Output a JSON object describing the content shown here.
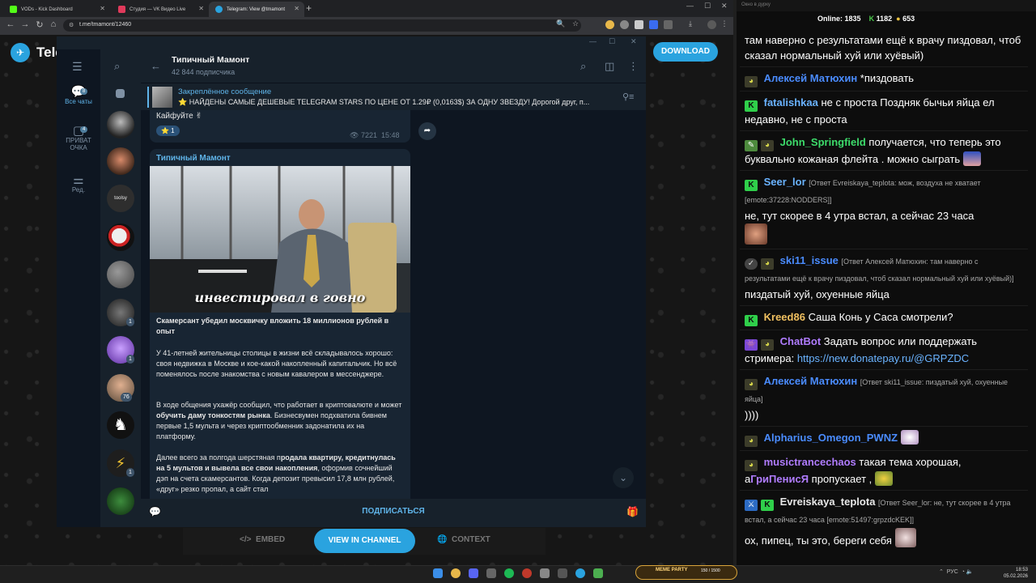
{
  "browser": {
    "tabs": [
      {
        "label": "VODs - Kick Dashboard",
        "favicon_color": "#53fc18"
      },
      {
        "label": "Студия — VK Видео Live",
        "favicon_color": "#e03a5b"
      },
      {
        "label": "Telegram: View @tmamont",
        "favicon_color": "#2aa3df"
      }
    ],
    "new_tab": "+",
    "url": "t.me/tmamont/12460"
  },
  "telegram_web": {
    "logo_word": "Tele",
    "download_label": "DOWNLOAD",
    "embed_label": "EMBED",
    "view_in_channel_label": "VIEW IN CHANNEL",
    "context_label": "CONTEXT"
  },
  "app": {
    "folders": [
      {
        "label": "Все чаты",
        "badge": "8",
        "icon": "chat-bubbles-icon"
      },
      {
        "label": "ПРИВАТ ОЧКА",
        "badge": "4",
        "icon": "chat-bubble-icon"
      },
      {
        "label": "Ред.",
        "icon": "sliders-icon"
      }
    ],
    "chat_badges": [
      "1",
      "1",
      "76",
      "1"
    ],
    "channel": {
      "title": "Типичный Мамонт",
      "subscribers": "42 844 подписчика"
    },
    "pinned": {
      "title": "Закреплённое сообщение",
      "text": "⭐ НАЙДЕНЫ САМЫЕ ДЕШЕВЫЕ TELEGRAM STARS ПО ЦЕНЕ ОТ 1.29₽ (0,0163$) ЗА ОДНУ ЗВЕЗДУ! Дорогой друг, п..."
    },
    "message1": {
      "text": "Кайфуйте ✌",
      "reaction": "⭐ 1",
      "views": "7221",
      "time": "15:48"
    },
    "post": {
      "author": "Типичный Мамонт",
      "image_caption": "инвестировал в говно",
      "headline": "Скамерсант убедил москвичку вложить 18 миллионов рублей в опыт",
      "p1": "У 41-летней жительницы столицы в жизни всё складывалось хорошо: своя недвижка в Москве и кое-какой накопленный капитальчик. Но всё поменялось после знакомства с новым кавалером в мессенджере.",
      "p2_a": "В ходе общения ухажёр сообщил, что работает в криптовалюте и может ",
      "p2_b": "обучить даму тонкостям рынка",
      "p2_c": ". Бизнесвумен подхватила бивнем первые 1,5 мульта и через криптообменник задонатила их на платформу.",
      "p3_a": "Далее всего за полгода шерстяная п",
      "p3_b": "родала квартиру, кредитнулась на 5 мультов и вывела все свои накопления",
      "p3_c": ", оформив сочнейший дэп на счета скамерсантов. Когда депозит превысил 17,8 млн рублей, «друг» резко пропал, а сайт стал"
    },
    "subscribe_label": "ПОДПИСАТЬСЯ"
  },
  "stream_chat": {
    "window_title": "Окно в дурку",
    "online_label": "Online:",
    "online_count": "1835",
    "kick_count": "1182",
    "other_count": "653",
    "messages": [
      {
        "user": "",
        "text": "там наверно с результатами ещё к врачу пиздовал, чтоб сказал нормальный хуй или хуёвый)",
        "color": "#ffffff"
      },
      {
        "user": "Алексей Матюхин",
        "text": "*пиздовать",
        "color": "#4a8cff"
      },
      {
        "user": "fatalishkaa",
        "text": "не с проста Поздняк бычьи яйца ел недавно, не с проста",
        "color": "#6ab3ff"
      },
      {
        "user": "John_Springfield",
        "text": "получается, что теперь это буквально кожаная флейта . можно сыграть",
        "color": "#3ddc6b"
      },
      {
        "user": "Seer_lor",
        "reply": "[Ответ Evreiskaya_teplota: мож, воздуха не хватает [emote:37228:NODDERS]]",
        "text": "не, тут скорее в 4 утра встал, а сейчас 23 часа",
        "color": "#6ab3ff"
      },
      {
        "user": "ski11_issue",
        "reply": "[Ответ Алексей Матюхин: там наверно с результатами ещё к врачу пиздовал, чтоб сказал нормальный хуй или хуёвый)]",
        "text": "пиздатый хуй, охуенные яйца",
        "color": "#4a8cff"
      },
      {
        "user": "Kreed86",
        "text": "Саша Конь у Саса смотрели?",
        "color": "#f0c060"
      },
      {
        "user": "ChatBot",
        "text": "Задать вопрос или поддержать стримера:",
        "link": "https://new.donatepay.ru/@GRPZDC",
        "color": "#b07cff"
      },
      {
        "user": "Алексей Матюхин",
        "reply": "[Ответ ski11_issue: пиздатый хуй, охуенные яйца]",
        "text": "))))",
        "color": "#4a8cff"
      },
      {
        "user": "Alpharius_Omegon_PWNZ",
        "text": "",
        "color": "#4a8cff"
      },
      {
        "user": "musictrancechaos",
        "text": "такая тема хорошая, а",
        "mention": "ГриПенисЯ",
        "text2": "пропускает ,",
        "color": "#b07cff"
      },
      {
        "user": "Evreiskaya_teplota",
        "reply": "[Ответ Seer_lor: не, тут скорее в 4 утра встал, а сейчас 23 часа [emote:51497:grpzdcKEK]]",
        "text": "ох, пипец, ты это, береги себя",
        "color": "#e8e8e8"
      }
    ]
  },
  "taskbar": {
    "meme_party": "MEME PARTY",
    "meme_progress": "150 / 1500",
    "lang": "РУС",
    "time": "18:53",
    "date": "05.02.2026"
  }
}
